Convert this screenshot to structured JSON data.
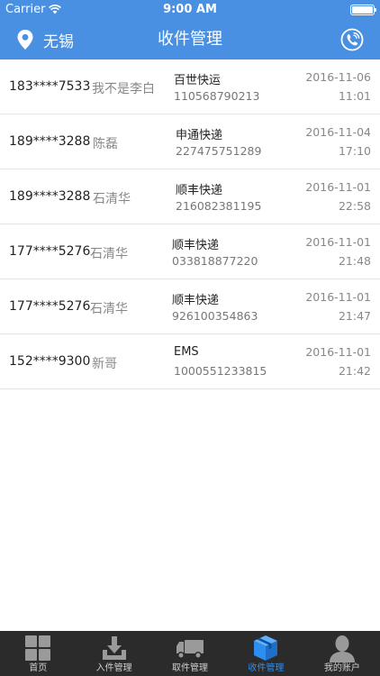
{
  "status_bar": {
    "carrier": "Carrier",
    "time": "9:00 AM"
  },
  "nav": {
    "city": "无锡",
    "title": "收件管理"
  },
  "rows": [
    {
      "phone": "183****7533",
      "name": "我不是李白",
      "company": "百世快运",
      "tracking": "110568790213",
      "date": "2016-11-06",
      "time": "11:01"
    },
    {
      "phone": "189****3288",
      "name": "陈磊",
      "company": "申通快递",
      "tracking": "227475751289",
      "date": "2016-11-04",
      "time": "17:10"
    },
    {
      "phone": "189****3288",
      "name": "石清华",
      "company": "顺丰快递",
      "tracking": "216082381195",
      "date": "2016-11-01",
      "time": "22:58"
    },
    {
      "phone": "177****5276",
      "name": "石清华",
      "company": "顺丰快递",
      "tracking": "033818877220",
      "date": "2016-11-01",
      "time": "21:48"
    },
    {
      "phone": "177****5276",
      "name": "石清华",
      "company": "顺丰快递",
      "tracking": "926100354863",
      "date": "2016-11-01",
      "time": "21:47"
    },
    {
      "phone": "152****9300",
      "name": "新哥",
      "company": "EMS",
      "tracking": "1000551233815",
      "date": "2016-11-01",
      "time": "21:42"
    }
  ],
  "tabs": [
    {
      "label": "首页",
      "icon": "grid-icon"
    },
    {
      "label": "入件管理",
      "icon": "inbox-download-icon"
    },
    {
      "label": "取件管理",
      "icon": "truck-icon"
    },
    {
      "label": "收件管理",
      "icon": "package-icon",
      "active": true
    },
    {
      "label": "我的账户",
      "icon": "user-icon"
    }
  ],
  "colors": {
    "primary": "#4a90e2",
    "tab_active": "#2e8ef0",
    "tab_bar_bg": "#2b2b2b"
  }
}
